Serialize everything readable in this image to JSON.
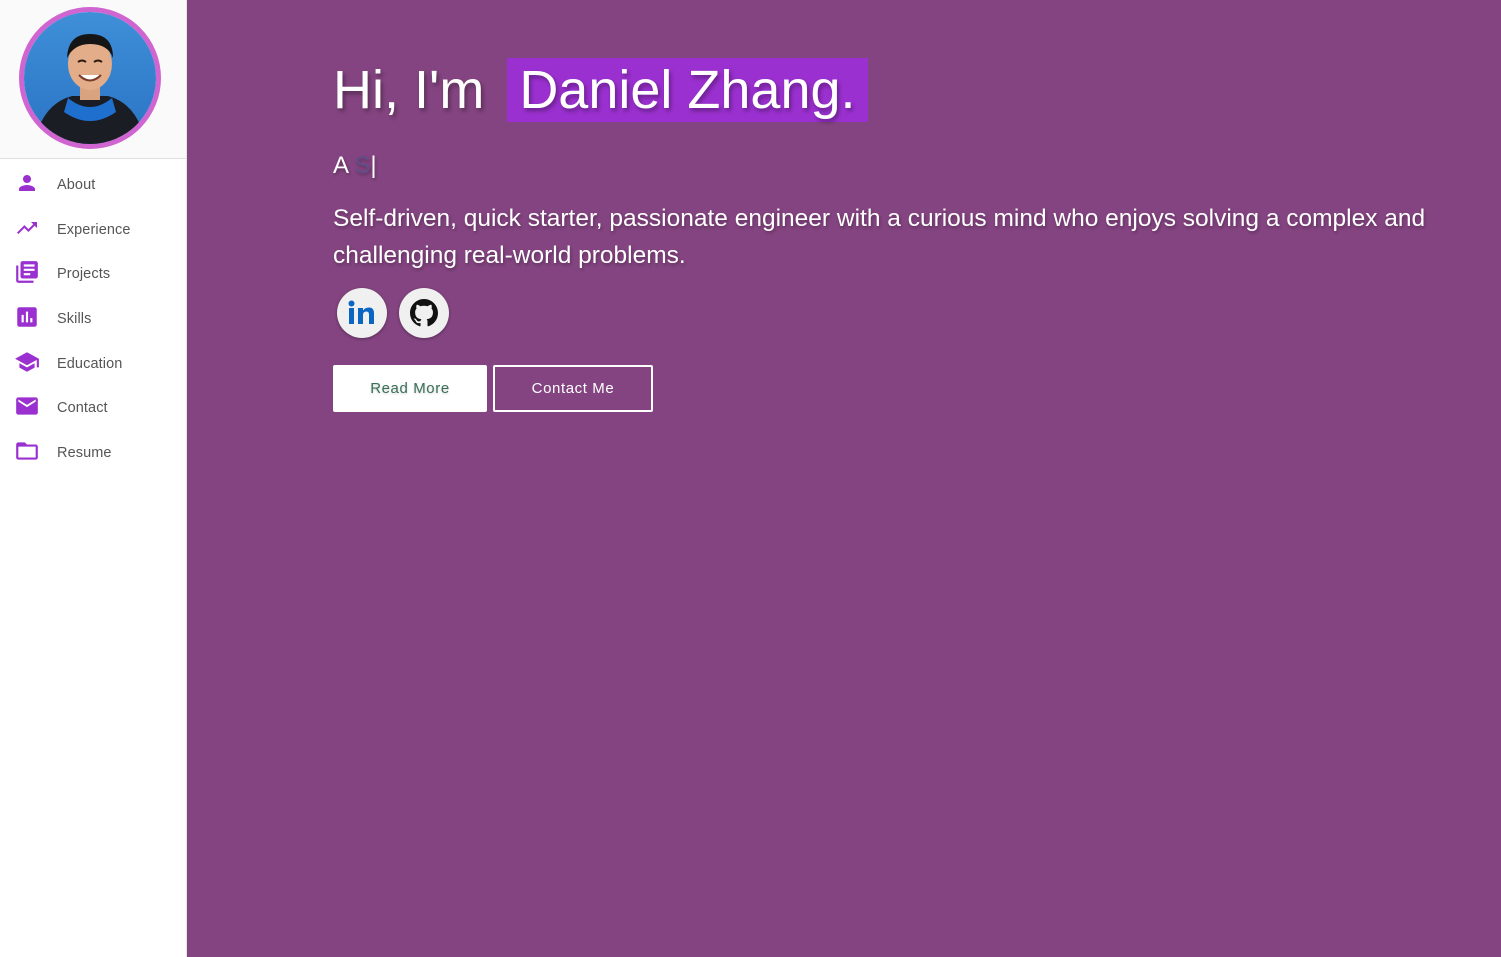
{
  "theme": {
    "accent": "#9b30d0",
    "main_bg": "#844481",
    "avatar_ring": "#d064d0"
  },
  "sidebar": {
    "avatar_alt": "profile photo",
    "items": [
      {
        "label": "About",
        "icon": "person-icon"
      },
      {
        "label": "Experience",
        "icon": "trending-up-icon"
      },
      {
        "label": "Projects",
        "icon": "library-books-icon"
      },
      {
        "label": "Skills",
        "icon": "bar-chart-icon"
      },
      {
        "label": "Education",
        "icon": "school-icon"
      },
      {
        "label": "Contact",
        "icon": "mail-icon"
      },
      {
        "label": "Resume",
        "icon": "folder-icon"
      }
    ]
  },
  "hero": {
    "greeting_prefix": "Hi, I'm",
    "name": "Daniel Zhang.",
    "typed_prefix": "A",
    "typed_partial": "S",
    "typed_cursor": "|",
    "tagline": "Self-driven, quick starter, passionate engineer with a curious mind who enjoys solving a complex and challenging real-world problems.",
    "socials": [
      {
        "name": "LinkedIn",
        "icon": "linkedin-icon"
      },
      {
        "name": "GitHub",
        "icon": "github-icon"
      }
    ],
    "read_more_label": "Read More",
    "contact_label": "Contact Me"
  }
}
